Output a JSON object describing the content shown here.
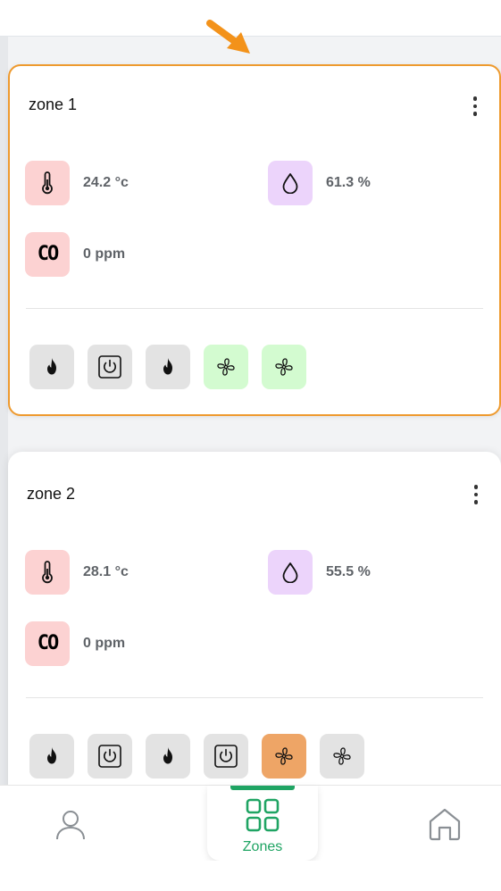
{
  "colors": {
    "accent_green": "#1fa463",
    "highlight_orange": "#ee9a2e",
    "badge_red": "#fcd2d2",
    "badge_purple": "#ecd4fb",
    "action_grey": "#e3e3e3",
    "action_green": "#d3fbd0",
    "action_orange": "#eea566"
  },
  "zones": [
    {
      "title": "zone 1",
      "temperature": "24.2 °c",
      "humidity": "61.3 %",
      "co_label": "CO",
      "co": "0 ppm",
      "actions": [
        {
          "icon": "flame-icon",
          "state": "off"
        },
        {
          "icon": "power-icon",
          "state": "off"
        },
        {
          "icon": "flame-icon",
          "state": "off"
        },
        {
          "icon": "fan-icon",
          "state": "on-green"
        },
        {
          "icon": "fan-icon",
          "state": "on-green"
        }
      ]
    },
    {
      "title": "zone 2",
      "temperature": "28.1 °c",
      "humidity": "55.5 %",
      "co_label": "CO",
      "co": "0 ppm",
      "actions": [
        {
          "icon": "flame-icon",
          "state": "off"
        },
        {
          "icon": "power-icon",
          "state": "off"
        },
        {
          "icon": "flame-icon",
          "state": "off"
        },
        {
          "icon": "power-icon",
          "state": "off"
        },
        {
          "icon": "fan-icon",
          "state": "on-orange"
        },
        {
          "icon": "fan-icon",
          "state": "off"
        }
      ]
    }
  ],
  "nav": {
    "items": [
      {
        "icon": "user-icon",
        "label": ""
      },
      {
        "icon": "grid-icon",
        "label": "Zones",
        "active": true
      },
      {
        "icon": "home-icon",
        "label": ""
      }
    ]
  }
}
